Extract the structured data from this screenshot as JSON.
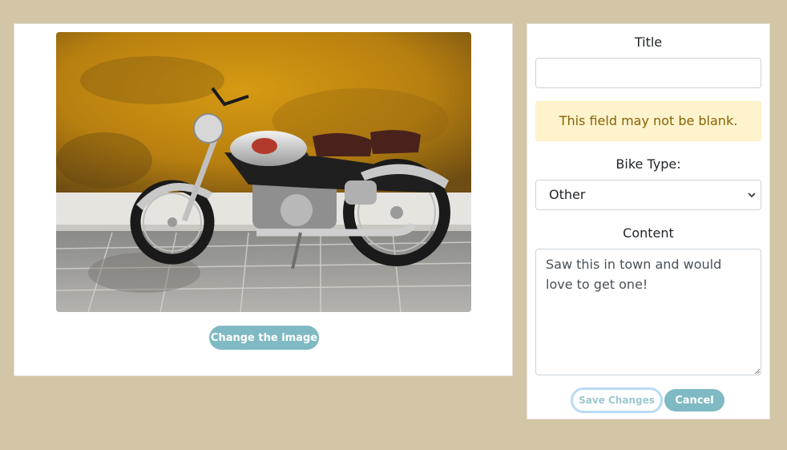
{
  "image_panel": {
    "photo_alt": "Motorcycle parked against a yellow wall",
    "change_image_label": "Change the image"
  },
  "form": {
    "title_label": "Title",
    "title_value": "",
    "title_error": "This field may not be blank.",
    "bike_type_label": "Bike Type:",
    "bike_type_selected": "Other",
    "content_label": "Content",
    "content_value": "Saw this in town and would love to get one!",
    "save_label": "Save Changes",
    "cancel_label": "Cancel"
  },
  "colors": {
    "page_background": "#d3c6a6",
    "accent": "#7fb9c3",
    "warning_background": "#fff3cd",
    "warning_text": "#856404"
  },
  "icons": {
    "select_chevron": "chevron-down-icon",
    "textarea_resize": "resize-grip-icon"
  }
}
